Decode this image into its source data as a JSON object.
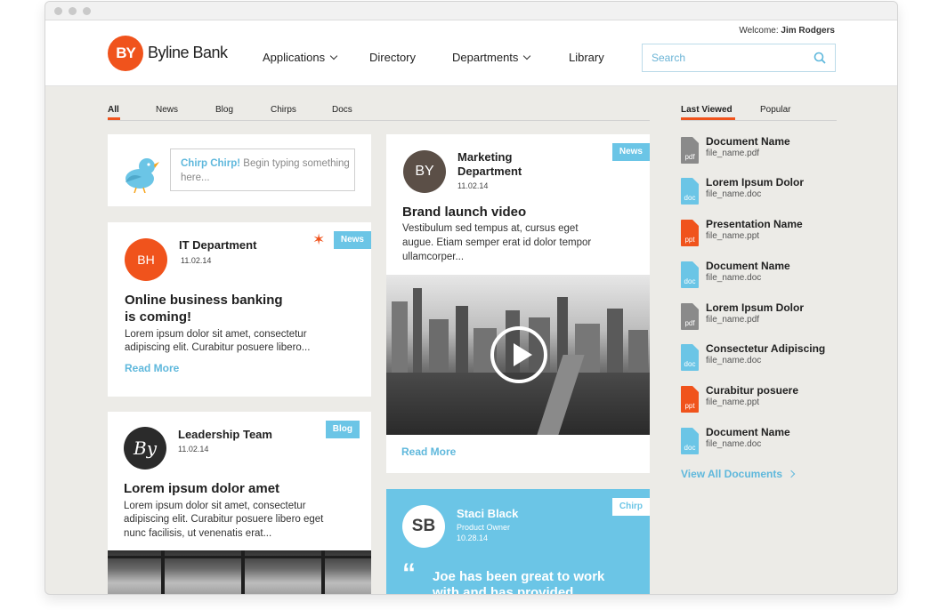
{
  "welcome": {
    "prefix": "Welcome:",
    "user": "Jim Rodgers"
  },
  "brand": {
    "mark": "BY",
    "name": "Byline Bank",
    "accent": "#f0531c"
  },
  "nav": [
    {
      "label": "Applications"
    },
    {
      "label": "Directory"
    },
    {
      "label": "Departments"
    },
    {
      "label": "Library"
    }
  ],
  "search": {
    "placeholder": "Search"
  },
  "filter_tabs": [
    "All",
    "News",
    "Blog",
    "Chirps",
    "Docs"
  ],
  "side_tabs": [
    "Last Viewed",
    "Popular"
  ],
  "chirp_box": {
    "prompt": "Chirp Chirp!",
    "hint": "Begin typing something here..."
  },
  "it_card": {
    "badge": "News",
    "avatar": "BH",
    "title": "IT Department",
    "date": "11.02.14",
    "headline_1": "Online business banking",
    "headline_2": "is coming!",
    "body_1": "Lorem ipsum dolor sit amet, consectetur",
    "body_2": "adipiscing elit. Curabitur posuere libero...",
    "read_more": "Read More"
  },
  "leadership_card": {
    "badge": "Blog",
    "avatar": "By",
    "title": "Leadership Team",
    "date": "11.02.14",
    "headline": "Lorem ipsum dolor amet",
    "body_1": "Lorem ipsum dolor sit amet, consectetur",
    "body_2": "adipiscing elit. Curabitur posuere libero eget",
    "body_3": "nunc facilisis, ut venenatis erat..."
  },
  "marketing_card": {
    "badge": "News",
    "avatar": "BY",
    "title_1": "Marketing",
    "title_2": "Department",
    "date": "11.02.14",
    "headline": "Brand launch video",
    "body_1": "Vestibulum sed tempus at, cursus eget",
    "body_2": "augue. Etiam semper erat id dolor tempor",
    "body_3": "ullamcorper...",
    "read_more": "Read More"
  },
  "staci_card": {
    "badge": "Chirp",
    "initials": "SB",
    "name": "Staci Black",
    "role": "Product Owner",
    "date": "10.28.14",
    "quote_1": "Joe has been great to work",
    "quote_2": "with and has provided"
  },
  "documents": [
    {
      "name": "Document Name",
      "file": "file_name.pdf",
      "ext": "pdf",
      "color": "#8a8a8a"
    },
    {
      "name": "Lorem Ipsum Dolor",
      "file": "file_name.doc",
      "ext": "doc",
      "color": "#6bc5e6"
    },
    {
      "name": "Presentation Name",
      "file": "file_name.ppt",
      "ext": "ppt",
      "color": "#f0531c"
    },
    {
      "name": "Document Name",
      "file": "file_name.doc",
      "ext": "doc",
      "color": "#6bc5e6"
    },
    {
      "name": "Lorem Ipsum Dolor",
      "file": "file_name.pdf",
      "ext": "pdf",
      "color": "#8a8a8a"
    },
    {
      "name": "Consectetur Adipiscing",
      "file": "file_name.doc",
      "ext": "doc",
      "color": "#6bc5e6"
    },
    {
      "name": "Curabitur posuere",
      "file": "file_name.ppt",
      "ext": "ppt",
      "color": "#f0531c"
    },
    {
      "name": "Document Name",
      "file": "file_name.doc",
      "ext": "doc",
      "color": "#6bc5e6"
    }
  ],
  "view_all": "View All Documents",
  "icons": [
    "search-icon",
    "chevron-down-icon",
    "bird-icon",
    "star-icon",
    "play-icon",
    "quote-icon",
    "chevron-right-icon",
    "file-icon"
  ]
}
